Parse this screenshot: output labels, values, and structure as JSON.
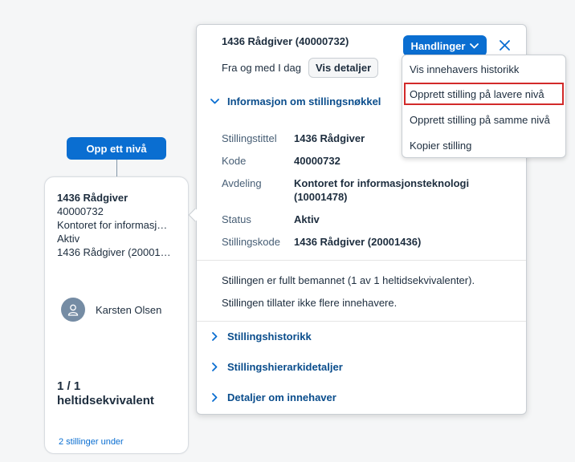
{
  "org_chart": {
    "up_button_label": "Opp ett nivå",
    "card": {
      "title": "1436 Rådgiver",
      "code": "40000732",
      "department": "Kontoret for informasj…",
      "status": "Aktiv",
      "position_code": "1436 Rådgiver (20001…",
      "holder_name": "Karsten Olsen",
      "fte_line1": "1 / 1",
      "fte_line2": "heltidsekvivalent",
      "positions_below_link": "2 stillinger under"
    }
  },
  "popover": {
    "title": "1436 Rådgiver (40000732)",
    "actions_button_label": "Handlinger",
    "from_label": "Fra og med I dag",
    "details_button_label": "Vis detaljer",
    "section_position_key": "Informasjon om stillingsnøkkel",
    "details": [
      {
        "label": "Stillingstittel",
        "value": "1436 Rådgiver"
      },
      {
        "label": "Kode",
        "value": "40000732"
      },
      {
        "label": "Avdeling",
        "value": "Kontoret for informasjonsteknologi (10001478)"
      },
      {
        "label": "Status",
        "value": "Aktiv"
      },
      {
        "label": "Stillingskode",
        "value": "1436 Rådgiver (20001436)"
      }
    ],
    "note_staffed": "Stillingen er fullt bemannet (1 av 1 heltidsekvivalenter).",
    "note_holders": "Stillingen tillater ikke flere innehavere.",
    "section_history": "Stillingshistorikk",
    "section_hierarchy": "Stillingshierarkidetaljer",
    "section_holder": "Detaljer om innehaver"
  },
  "actions_menu": {
    "items": [
      "Vis innehavers historikk",
      "Opprett stilling på lavere nivå",
      "Opprett stilling på samme nivå",
      "Kopier stilling"
    ]
  },
  "colors": {
    "accent": "#0a6ed1",
    "highlight_border": "#d22a2a",
    "section_text": "#0a4d8c"
  }
}
